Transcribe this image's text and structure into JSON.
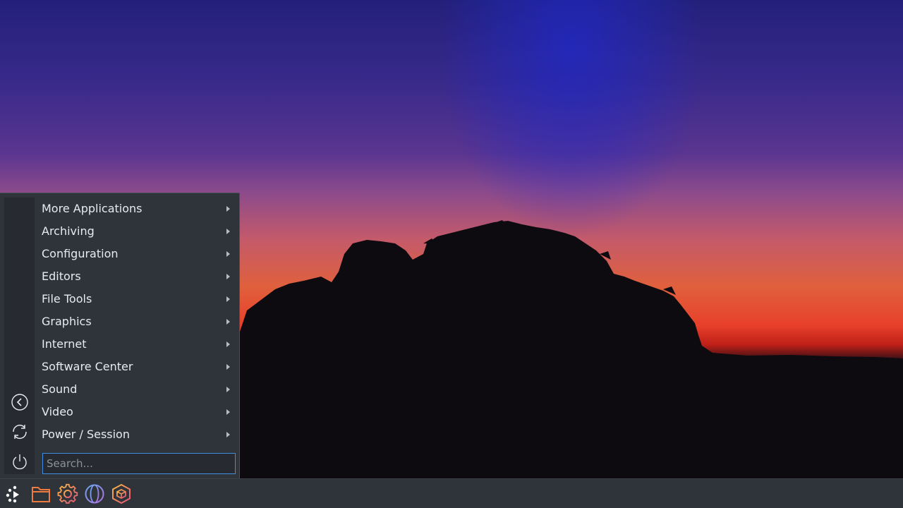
{
  "menu": {
    "items": [
      {
        "label": "More Applications"
      },
      {
        "label": "Archiving"
      },
      {
        "label": "Configuration"
      },
      {
        "label": "Editors"
      },
      {
        "label": "File Tools"
      },
      {
        "label": "Graphics"
      },
      {
        "label": "Internet"
      },
      {
        "label": "Software Center"
      },
      {
        "label": "Sound"
      },
      {
        "label": "Video"
      },
      {
        "label": "Power / Session"
      }
    ],
    "side_buttons": [
      "back-icon",
      "refresh-icon",
      "power-icon"
    ],
    "search": {
      "placeholder": "Search...",
      "value": ""
    }
  },
  "taskbar": {
    "launchers": [
      "app-menu-icon",
      "folder-icon",
      "settings-gear-icon",
      "web-browser-globe-icon",
      "package-manager-icon"
    ]
  },
  "colors": {
    "panel_bg": "#2f343b",
    "accent": "#3d8ee0",
    "menu_text": "#e8eaed"
  }
}
